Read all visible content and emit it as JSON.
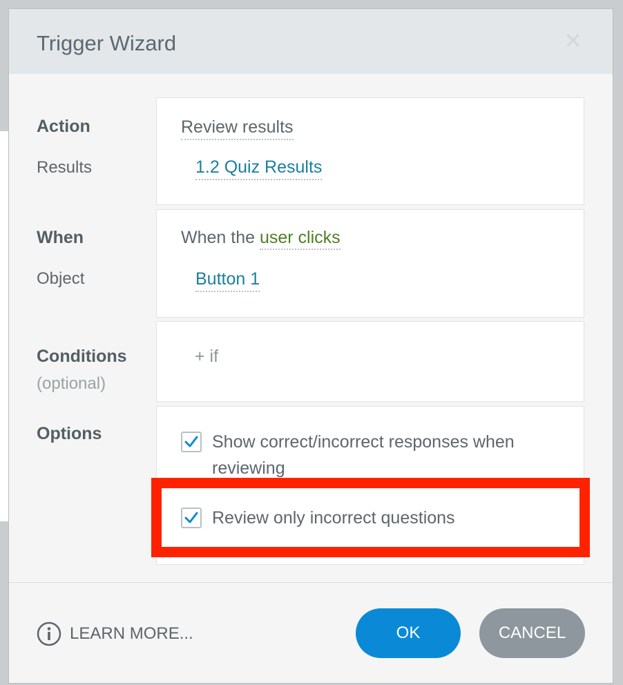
{
  "dialog": {
    "title": "Trigger Wizard",
    "close_label": "✕"
  },
  "labels": {
    "action": "Action",
    "results": "Results",
    "when": "When",
    "object": "Object",
    "conditions": "Conditions",
    "optional": "(optional)",
    "options": "Options"
  },
  "action_panel": {
    "action_value": "Review results",
    "results_value": "1.2 Quiz Results"
  },
  "when_panel": {
    "prefix": "When the ",
    "event_value": "user clicks",
    "object_value": "Button 1"
  },
  "conditions_panel": {
    "add_condition": "+ if"
  },
  "options_panel": {
    "option1_label": "Show correct/incorrect responses when reviewing",
    "option1_checked": true,
    "option2_label": "Review only incorrect questions",
    "option2_checked": true
  },
  "footer": {
    "learn_more": "LEARN MORE...",
    "ok_label": "OK",
    "cancel_label": "CANCEL"
  },
  "colors": {
    "accent_blue": "#0a8ad6",
    "link_blue": "#1a7f9e",
    "event_green": "#4e7f24",
    "cancel_gray": "#8d979d",
    "highlight_red": "#ff2200"
  },
  "icons": {
    "close": "close-icon",
    "check": "checkmark-icon",
    "info": "info-circle-icon"
  }
}
